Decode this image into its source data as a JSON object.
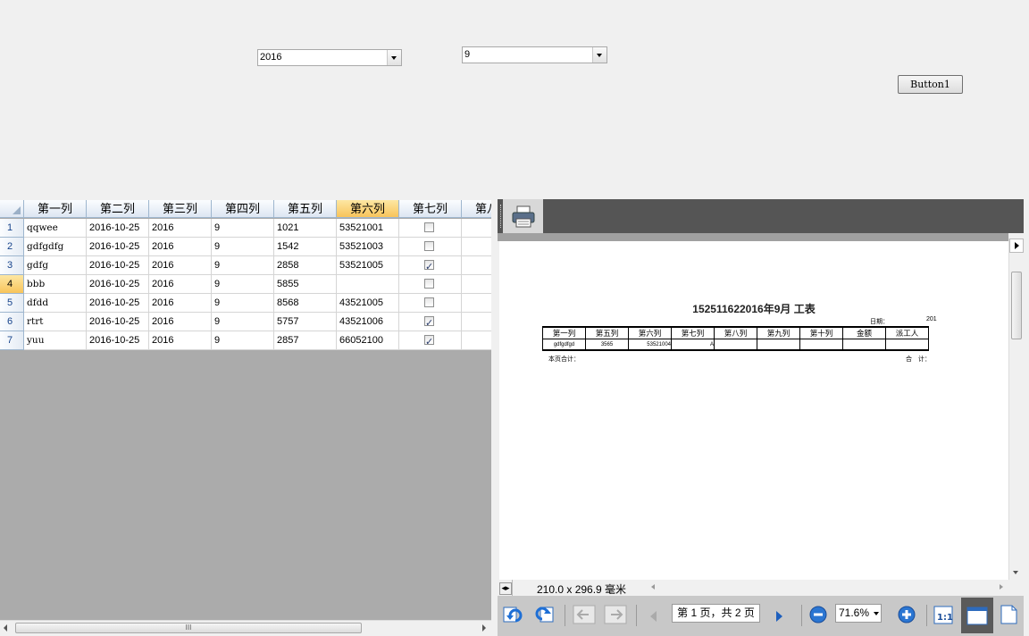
{
  "filters": {
    "year": "2016",
    "month": "9",
    "button_label": "Button1"
  },
  "grid": {
    "columns": [
      "第一列",
      "第二列",
      "第三列",
      "第四列",
      "第五列",
      "第六列",
      "第七列",
      "第八列"
    ],
    "selected_column": 5,
    "selected_row": 3,
    "rows": [
      {
        "num": "1",
        "c1": "qqwee",
        "c2": "2016-10-25",
        "c3": "2016",
        "c4": "9",
        "c5": "1021",
        "c6": "53521001",
        "c7": false
      },
      {
        "num": "2",
        "c1": "gdfgdfg",
        "c2": "2016-10-25",
        "c3": "2016",
        "c4": "9",
        "c5": "1542",
        "c6": "53521003",
        "c7": false
      },
      {
        "num": "3",
        "c1": "gdfg",
        "c2": "2016-10-25",
        "c3": "2016",
        "c4": "9",
        "c5": "2858",
        "c6": "53521005",
        "c7": true
      },
      {
        "num": "4",
        "c1": "bbb",
        "c2": "2016-10-25",
        "c3": "2016",
        "c4": "9",
        "c5": "5855",
        "c6": "",
        "c7": false
      },
      {
        "num": "5",
        "c1": "dfdd",
        "c2": "2016-10-25",
        "c3": "2016",
        "c4": "9",
        "c5": "8568",
        "c6": "43521005",
        "c7": false
      },
      {
        "num": "6",
        "c1": "rtrt",
        "c2": "2016-10-25",
        "c3": "2016",
        "c4": "9",
        "c5": "5757",
        "c6": "43521006",
        "c7": true
      },
      {
        "num": "7",
        "c1": "yuu",
        "c2": "2016-10-25",
        "c3": "2016",
        "c4": "9",
        "c5": "2857",
        "c6": "66052100",
        "c7": true
      }
    ],
    "scrollbar_grip": "III"
  },
  "report": {
    "title": "152511622016年9月 工表",
    "date_label": "日期：",
    "date_value": "201",
    "columns": [
      "第一列",
      "第五列",
      "第六列",
      "第七列",
      "第八列",
      "第九列",
      "第十列",
      "金额",
      "派工人"
    ],
    "row": [
      "gdfgdfgd",
      "3565",
      "53521004",
      "A",
      "",
      "",
      "",
      "",
      ""
    ],
    "page_total_label": "本页合计：",
    "total_label": "合　计："
  },
  "viewer": {
    "page_size": "210.0 x 296.9 毫米",
    "page_info": "第 1 页，共 2 页",
    "zoom": "71.6%"
  },
  "icons": [
    "print-icon",
    "refresh-icon",
    "refresh-alt-icon",
    "back-arrow-icon",
    "forward-arrow-icon",
    "prev-page-icon",
    "next-page-icon",
    "zoom-out-icon",
    "zoom-in-icon",
    "actual-size-icon",
    "page-width-icon",
    "whole-page-icon"
  ]
}
